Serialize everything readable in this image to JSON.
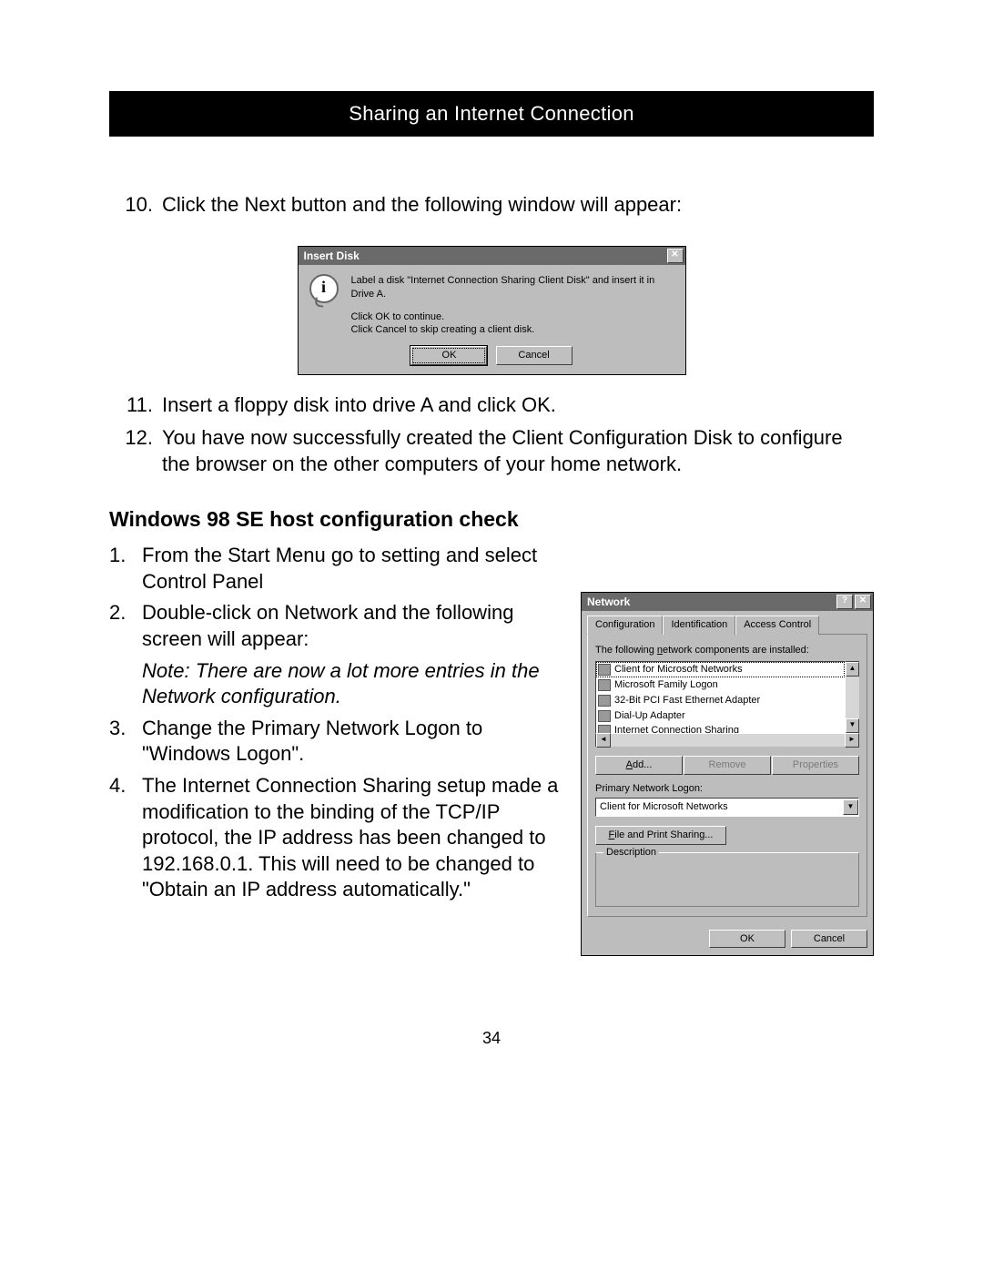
{
  "banner": "Sharing an Internet Connection",
  "step10_num": "10.",
  "step10_text": "Click the Next button and the following window will appear:",
  "insert_disk": {
    "title": "Insert Disk",
    "close_glyph": "✕",
    "info_glyph": "i",
    "msg1": "Label a disk \"Internet Connection Sharing Client Disk\" and insert it in Drive A.",
    "msg2a": "Click OK to continue.",
    "msg2b": "Click Cancel to skip creating a client disk.",
    "ok": "OK",
    "cancel": "Cancel"
  },
  "step11_num": "11.",
  "step11_text": "Insert a floppy disk into drive A and click OK.",
  "step12_num": "12.",
  "step12_text": "You have now successfully created the Client Configuration Disk to configure the browser on the other computers of your home network.",
  "section_title": "Windows 98 SE host configuration check",
  "check": {
    "s1_num": "1.",
    "s1_text": "From the Start Menu go to setting and select Control Panel",
    "s2_num": "2.",
    "s2_text": "Double-click on Network and the following screen will appear:",
    "note": "Note: There are now a lot more entries in the Network configuration.",
    "s3_num": "3.",
    "s3_text": "Change the Primary Network Logon to \"Windows Logon\".",
    "s4_num": "4.",
    "s4_text": "The Internet Connection Sharing setup made a modification to the binding of the TCP/IP protocol, the IP address has been changed to 192.168.0.1. This will need to be changed to \"Obtain an IP address automatically.\""
  },
  "network": {
    "title": "Network",
    "help_glyph": "?",
    "close_glyph": "✕",
    "tab_configuration": "Configuration",
    "tab_identification": "Identification",
    "tab_access": "Access Control",
    "installed_label_pre": "The following ",
    "installed_label_u": "n",
    "installed_label_post": "etwork components are installed:",
    "items": [
      "Client for Microsoft Networks",
      "Microsoft Family Logon",
      "32-Bit PCI Fast Ethernet Adapter",
      "Dial-Up Adapter",
      "Internet Connection Sharing"
    ],
    "add": "Add...",
    "remove": "Remove",
    "properties": "Properties",
    "primary_label": "Primary Network Logon:",
    "primary_value": "Client for Microsoft Networks",
    "file_print": "File and Print Sharing...",
    "description_label": "Description",
    "ok": "OK",
    "cancel": "Cancel",
    "up_glyph": "▲",
    "down_glyph": "▼",
    "left_glyph": "◄",
    "right_glyph": "►",
    "drop_glyph": "▼"
  },
  "page_number": "34"
}
